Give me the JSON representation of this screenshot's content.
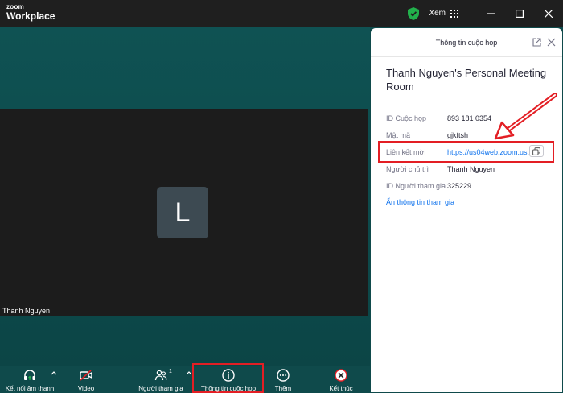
{
  "app": {
    "brand_small": "zoom",
    "brand_big": "Workplace",
    "view_label": "Xem"
  },
  "video": {
    "avatar_letter": "L",
    "participant_name": "Thanh Nguyen"
  },
  "panel": {
    "title": "Thông tin cuộc họp",
    "room_title": "Thanh Nguyen's Personal Meeting Room",
    "rows": [
      {
        "label": "ID Cuộc họp",
        "value": "893 181 0354"
      },
      {
        "label": "Mật mã",
        "value": "gjkftsh"
      },
      {
        "label": "Liên kết mời",
        "value": "https://us04web.zoom.us..."
      },
      {
        "label": "Người chủ trì",
        "value": "Thanh Nguyen"
      },
      {
        "label": "ID Người tham gia",
        "value": "325229"
      }
    ],
    "hide_link": "Ẩn thông tin tham gia"
  },
  "toolbar": {
    "audio": "Kết nối âm thanh",
    "video": "Video",
    "participants": "Người tham gia",
    "participants_count": "1",
    "meeting_info": "Thông tin cuộc họp",
    "more": "Thêm",
    "end": "Kết thúc"
  },
  "colors": {
    "accent_blue": "#0e72ed",
    "annotation_red": "#e31e24",
    "stage_teal": "#0f4a4b",
    "secure_green": "#22b14c"
  }
}
